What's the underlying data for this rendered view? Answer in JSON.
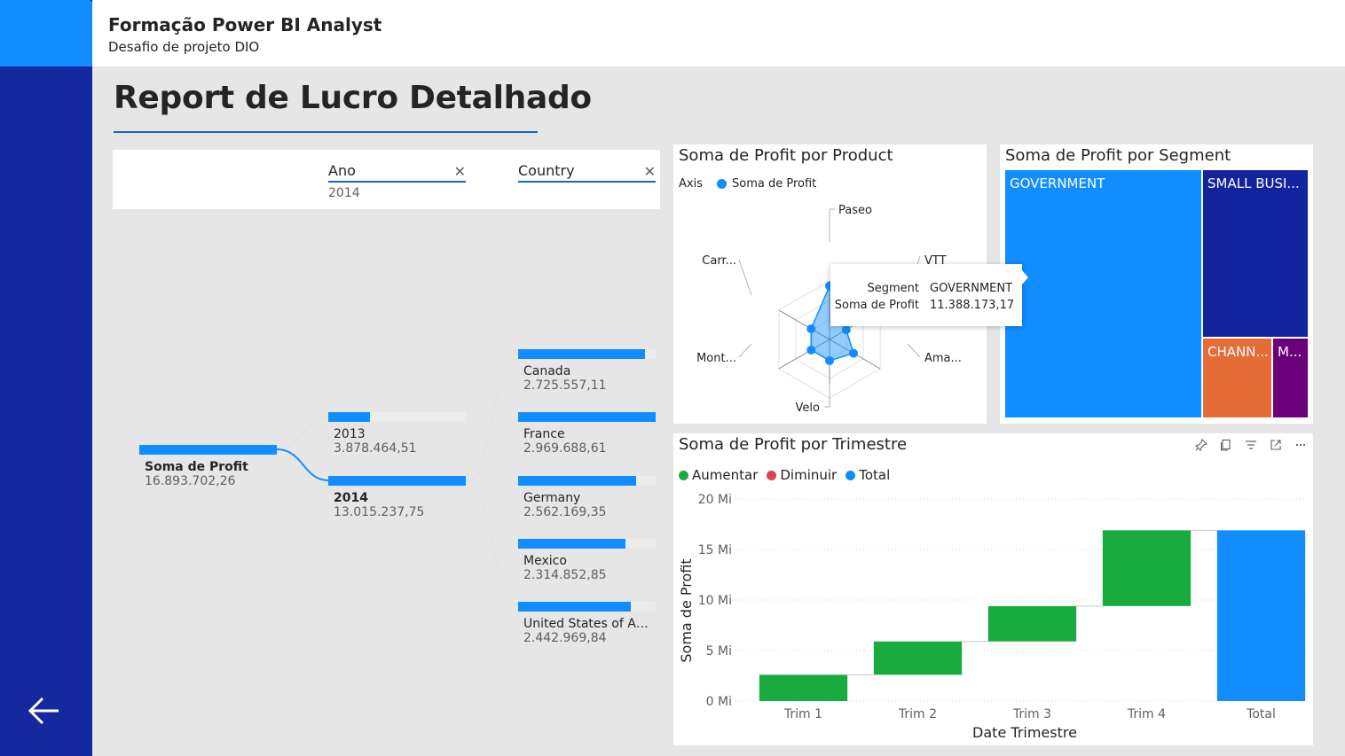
{
  "header": {
    "title": "Formação Power BI Analyst",
    "subtitle": "Desafio de projeto DIO"
  },
  "page": {
    "title": "Report de Lucro Detalhado"
  },
  "slicers": [
    {
      "label": "Ano",
      "value": "2014",
      "clear_icon": "close-icon"
    },
    {
      "label": "Country",
      "value": "",
      "clear_icon": "close-icon"
    }
  ],
  "decomposition_tree": {
    "root": {
      "label": "Soma de Profit",
      "value": "16.893.702,26",
      "fill": 1.0
    },
    "years": [
      {
        "label": "2013",
        "value": "3.878.464,51",
        "fill": 0.3
      },
      {
        "label": "2014",
        "value": "13.015.237,75",
        "fill": 1.0
      }
    ],
    "countries": [
      {
        "label": "Canada",
        "value": "2.725.557,11",
        "fill": 0.92
      },
      {
        "label": "France",
        "value": "2.969.688,61",
        "fill": 1.0
      },
      {
        "label": "Germany",
        "value": "2.562.169,35",
        "fill": 0.86
      },
      {
        "label": "Mexico",
        "value": "2.314.852,85",
        "fill": 0.78
      },
      {
        "label": "United States of Ameri...",
        "value": "2.442.969,84",
        "fill": 0.82
      }
    ]
  },
  "radar": {
    "title": "Soma de Profit por Product",
    "legend_axis": "Axis",
    "legend_series": "Soma de Profit",
    "color": "#118dff"
  },
  "treemap": {
    "title": "Soma de Profit por Segment",
    "cells": [
      {
        "label": "GOVERNMENT",
        "color": "#118dff"
      },
      {
        "label": "SMALL BUSI...",
        "color": "#12239e"
      },
      {
        "label": "CHANN...",
        "color": "#e66c37"
      },
      {
        "label": "M...",
        "color": "#6b007b"
      }
    ]
  },
  "tooltip": {
    "rows": [
      {
        "key": "Segment",
        "value": "GOVERNMENT"
      },
      {
        "key": "Soma de Profit",
        "value": "11.388.173,17"
      }
    ]
  },
  "waterfall": {
    "title": "Soma de Profit por Trimestre",
    "legend": [
      {
        "label": "Aumentar",
        "color": "#1aab40"
      },
      {
        "label": "Diminuir",
        "color": "#d64554"
      },
      {
        "label": "Total",
        "color": "#118dff"
      }
    ],
    "toolbar_icons": [
      "pin-icon",
      "copy-icon",
      "filter-icon",
      "focus-mode-icon",
      "more-options-icon"
    ]
  },
  "chart_data": [
    {
      "type": "radar",
      "title": "Soma de Profit por Product",
      "axes": [
        "Paseo",
        "VTT",
        "Ama...",
        "Velo",
        "Mont...",
        "Carr..."
      ],
      "series": [
        {
          "name": "Soma de Profit",
          "values": [
            0.83,
            0.3,
            0.43,
            0.33,
            0.33,
            0.33
          ]
        }
      ]
    },
    {
      "type": "treemap",
      "title": "Soma de Profit por Segment",
      "categories": [
        "GOVERNMENT",
        "SMALL BUSI...",
        "CHANN...",
        "M..."
      ],
      "values": [
        11388173.17,
        3300000,
        1400000,
        800000
      ]
    },
    {
      "type": "bar",
      "subtype": "waterfall",
      "title": "Soma de Profit por Trimestre",
      "xlabel": "Date Trimestre",
      "ylabel": "Soma de Profit",
      "categories": [
        "Trim 1",
        "Trim 2",
        "Trim 3",
        "Trim 4",
        "Total"
      ],
      "values": [
        2.6,
        3.3,
        3.5,
        7.5,
        16.9
      ],
      "value_unit": "Mi",
      "kinds": [
        "increase",
        "increase",
        "increase",
        "increase",
        "total"
      ],
      "ylim": [
        0,
        20
      ],
      "yticks": [
        "0 Mi",
        "5 Mi",
        "10 Mi",
        "15 Mi",
        "20 Mi"
      ],
      "grid": true
    }
  ]
}
